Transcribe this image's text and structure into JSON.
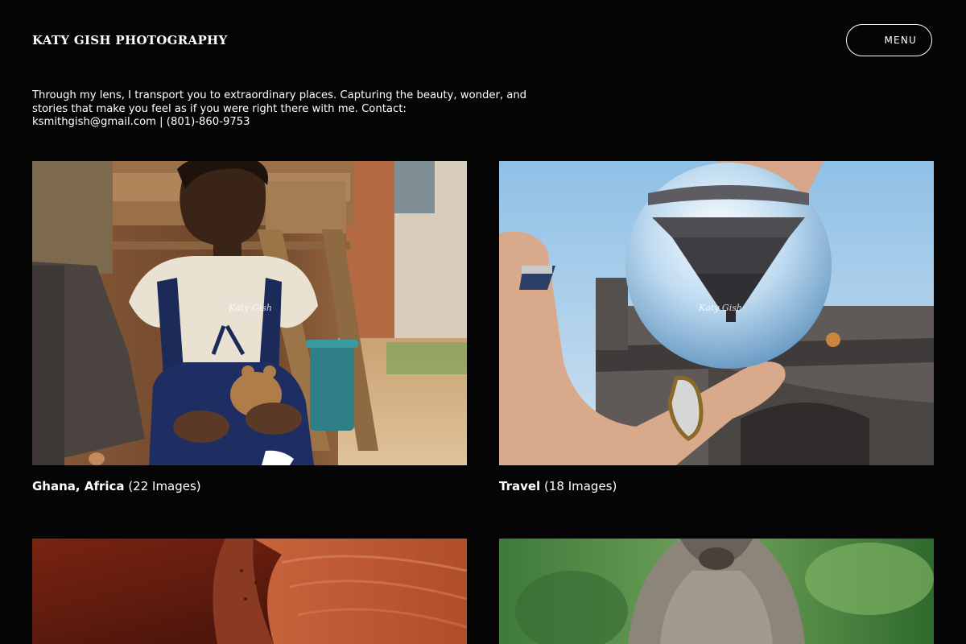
{
  "header": {
    "brand": "KATY GISH PHOTOGRAPHY",
    "menu_label": "MENU"
  },
  "intro": {
    "text": "Through my lens, I transport you to extraordinary places. Capturing the beauty, wonder, and stories that make you feel as if you were right there with me. Contact: ksmithgish@gmail.com | (801)-860-9753"
  },
  "galleries": [
    {
      "title": "Ghana, Africa",
      "count": "(22 Images)",
      "watermark": "Katy Gish",
      "image": "girl-with-teddy-bear-photo"
    },
    {
      "title": "Travel",
      "count": "(18 Images)",
      "watermark": "Katy Gish",
      "image": "crystal-ball-eiffel-tower-photo"
    },
    {
      "title": "",
      "count": "",
      "image": "red-sandstone-canyon-photo"
    },
    {
      "title": "",
      "count": "",
      "image": "baboon-portrait-photo"
    }
  ],
  "colors": {
    "background": "#050505",
    "text": "#ffffff"
  }
}
